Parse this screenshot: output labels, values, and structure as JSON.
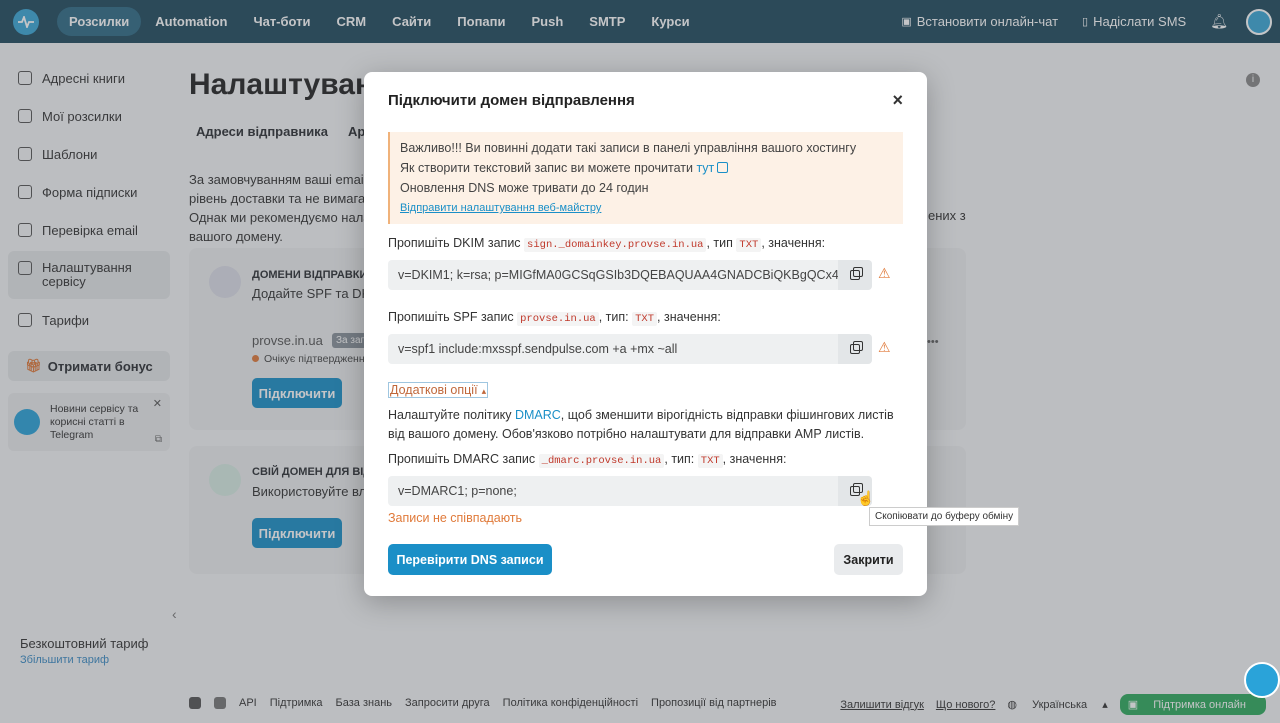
{
  "nav": {
    "items": [
      "Розсилки",
      "Automation",
      "Чат-боти",
      "CRM",
      "Сайти",
      "Попапи",
      "Push",
      "SMTP",
      "Курси"
    ],
    "install_chat": "Встановити онлайн-чат",
    "send_sms": "Надіслати SMS"
  },
  "sidebar": {
    "items": [
      "Адресні книги",
      "Мої розсилки",
      "Шаблони",
      "Форма підписки",
      "Перевірка email",
      "Налаштування сервісу",
      "Тарифи"
    ],
    "bonus": "Отримати бонус",
    "telegram_text": "Новини сервісу та корисні статті в Telegram",
    "tariff": "Безкоштовний тариф",
    "upgrade": "Збільшити тариф"
  },
  "page": {
    "title": "Налаштуван",
    "tabs": [
      "Адреси відправника",
      "Архі"
    ],
    "text_lines": [
      "За замовчуванням ваші email",
      "рівень доставки та не вимагає",
      "Однак ми рекомендуємо нала",
      "вашого домену."
    ],
    "text_right": "ених з",
    "card1": {
      "title": "ДОМЕНИ ВІДПРАВКИ",
      "sub": "Додайте SPF та DK",
      "domain": "provse.in.ua",
      "tag": "За зап",
      "pending": "Очікує підтвердженн",
      "button": "Підключити",
      "dots": "•••"
    },
    "card2": {
      "title": "СВІЙ ДОМЕН ДЛЯ ВІДП",
      "sub": "Використовуйте вл",
      "button": "Підключити"
    }
  },
  "footer": {
    "links": [
      "API",
      "Підтримка",
      "База знань",
      "Запросити друга",
      "Політика конфіденційності",
      "Пропозиції від партнерів"
    ],
    "feedback": "Залишити відгук",
    "whats_new": "Що нового?",
    "language": "Українська",
    "support": "Підтримка онлайн"
  },
  "modal": {
    "title": "Підключити домен відправлення",
    "notice": {
      "line1": "Важливо!!! Ви повинні додати такі записи в панелі управління вашого хостингу",
      "line2": "Як створити текстовий запис ви можете прочитати",
      "line2_link": "тут",
      "line3": "Оновлення DNS може тривати до 24 годин",
      "send_link": "Відправити налаштування веб-майстру"
    },
    "dkim": {
      "label_pre": "Пропишіть DKIM запис",
      "record": "sign._domainkey.provse.in.ua",
      "label_mid": ", тип",
      "type": "TXT",
      "label_post": ", значення:",
      "value": "v=DKIM1; k=rsa; p=MIGfMA0GCSqGSIb3DQEBAQUAA4GNADCBiQKBgQCx4l"
    },
    "spf": {
      "label_pre": "Пропишіть SPF запис",
      "record": "provse.in.ua",
      "label_mid": ", тип:",
      "type": "TXT",
      "label_post": ", значення:",
      "value": "v=spf1 include:mxsspf.sendpulse.com +a +mx ~all"
    },
    "options_link": "Додаткові опції",
    "dmarc_text_pre": "Налаштуйте політику",
    "dmarc_link": "DMARC",
    "dmarc_text_post": ", щоб зменшити вірогідність відправки фішингових листів від вашого домену. Обов'язково потрібно налаштувати для відправки AMP листів.",
    "dmarc": {
      "label_pre": "Пропишіть DMARC запис",
      "record": "_dmarc.provse.in.ua",
      "label_mid": ", тип:",
      "type": "TXT",
      "label_post": ", значення:",
      "value": "v=DMARC1; p=none;"
    },
    "mismatch": "Записи не співпадають",
    "check_button": "Перевірити DNS записи",
    "close_button": "Закрити",
    "tooltip": "Скопіювати до буферу обміну"
  }
}
